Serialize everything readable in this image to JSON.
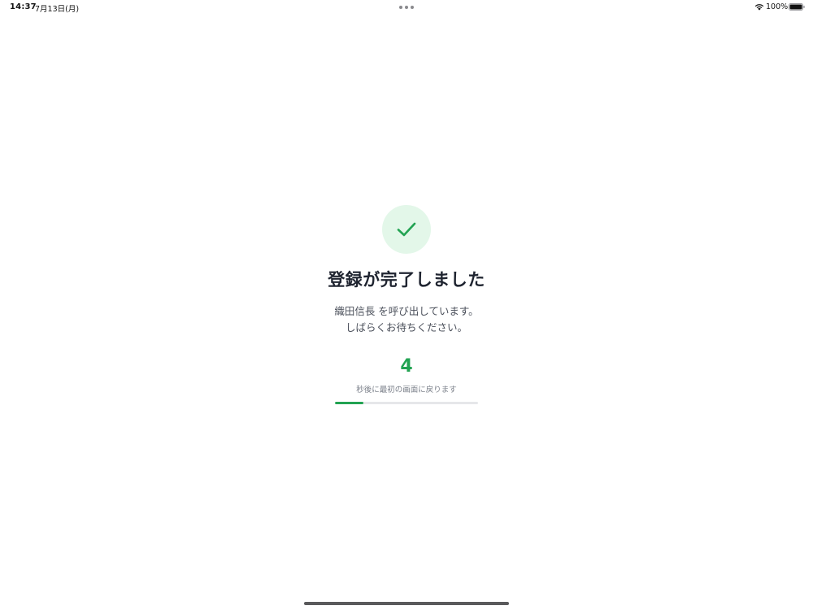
{
  "status_bar": {
    "time": "14:37",
    "date": "7月13日(月)",
    "battery_percent_label": "100%",
    "battery_level": 1.0
  },
  "success": {
    "icon": "checkmark-icon",
    "title": "登録が完了しました",
    "message_line1": "織田信長 を呼び出しています。",
    "message_line2": "しばらくお待ちください。"
  },
  "countdown": {
    "seconds": "4",
    "caption": "秒後に最初の画面に戻ります",
    "progress_fraction": 0.2
  },
  "colors": {
    "accent": "#22a352",
    "accent_light": "#e3f7e9",
    "title_text": "#1f2430",
    "track": "#e6e7ea"
  }
}
